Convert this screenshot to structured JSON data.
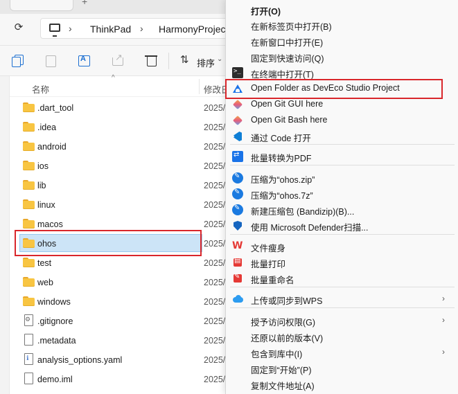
{
  "address": {
    "crumbs": [
      "ThinkPad",
      "HarmonyProjec"
    ]
  },
  "toolbar": {
    "sort_label": "排序"
  },
  "columns": {
    "name": "名称",
    "modified": "修改日"
  },
  "files": [
    {
      "name": ".dart_tool",
      "type": "folder",
      "date": "2025/"
    },
    {
      "name": ".idea",
      "type": "folder",
      "date": "2025/"
    },
    {
      "name": "android",
      "type": "folder",
      "date": "2025/"
    },
    {
      "name": "ios",
      "type": "folder",
      "date": "2025/"
    },
    {
      "name": "lib",
      "type": "folder",
      "date": "2025/"
    },
    {
      "name": "linux",
      "type": "folder",
      "date": "2025/"
    },
    {
      "name": "macos",
      "type": "folder",
      "date": "2025/"
    },
    {
      "name": "ohos",
      "type": "folder",
      "date": "2025/",
      "selected": true
    },
    {
      "name": "test",
      "type": "folder",
      "date": "2025/"
    },
    {
      "name": "web",
      "type": "folder",
      "date": "2025/"
    },
    {
      "name": "windows",
      "type": "folder",
      "date": "2025/"
    },
    {
      "name": ".gitignore",
      "type": "file-gear",
      "date": "2025/"
    },
    {
      "name": ".metadata",
      "type": "file",
      "date": "2025/"
    },
    {
      "name": "analysis_options.yaml",
      "type": "file-doc",
      "date": "2025/"
    },
    {
      "name": "demo.iml",
      "type": "file",
      "date": "2025/"
    }
  ],
  "context_menu": {
    "items": [
      {
        "label": "打开(O)",
        "icon": "",
        "bold": true
      },
      {
        "label": "在新标签页中打开(B)",
        "icon": ""
      },
      {
        "label": "在新窗口中打开(E)",
        "icon": ""
      },
      {
        "label": "固定到快速访问(Q)",
        "icon": ""
      },
      {
        "label": "在终端中打开(T)",
        "icon": "terminal-icon"
      },
      {
        "label": "Open Folder as DevEco Studio Project",
        "icon": "deveco-icon"
      },
      {
        "label": "Open Git GUI here",
        "icon": "git-icon"
      },
      {
        "label": "Open Git Bash here",
        "icon": "git-icon"
      },
      {
        "label": "通过 Code 打开",
        "icon": "vscode-icon"
      },
      {
        "label": "批量转换为PDF",
        "icon": "pdf-convert-icon"
      },
      {
        "label": "压缩为“ohos.zip”",
        "icon": "bandizip-icon"
      },
      {
        "label": "压缩为“ohos.7z”",
        "icon": "bandizip-icon"
      },
      {
        "label": "新建压缩包 (Bandizip)(B)...",
        "icon": "bandizip-icon"
      },
      {
        "label": "使用 Microsoft Defender扫描...",
        "icon": "defender-icon"
      },
      {
        "label": "文件瘦身",
        "icon": "wps-icon"
      },
      {
        "label": "批量打印",
        "icon": "print-icon"
      },
      {
        "label": "批量重命名",
        "icon": "rename-icon"
      },
      {
        "label": "上传或同步到WPS",
        "icon": "cloud-icon",
        "submenu": true
      },
      {
        "label": "授予访问权限(G)",
        "icon": "",
        "submenu": true
      },
      {
        "label": "还原以前的版本(V)",
        "icon": ""
      },
      {
        "label": "包含到库中(I)",
        "icon": "",
        "submenu": true
      },
      {
        "label": "固定到“开始”(P)",
        "icon": ""
      },
      {
        "label": "复制文件地址(A)",
        "icon": ""
      }
    ],
    "submenu_arrow": "›"
  },
  "colors": {
    "highlight_red": "#d9262b",
    "selection_blue": "#cce4f7",
    "folder_yellow": "#f8c542"
  }
}
